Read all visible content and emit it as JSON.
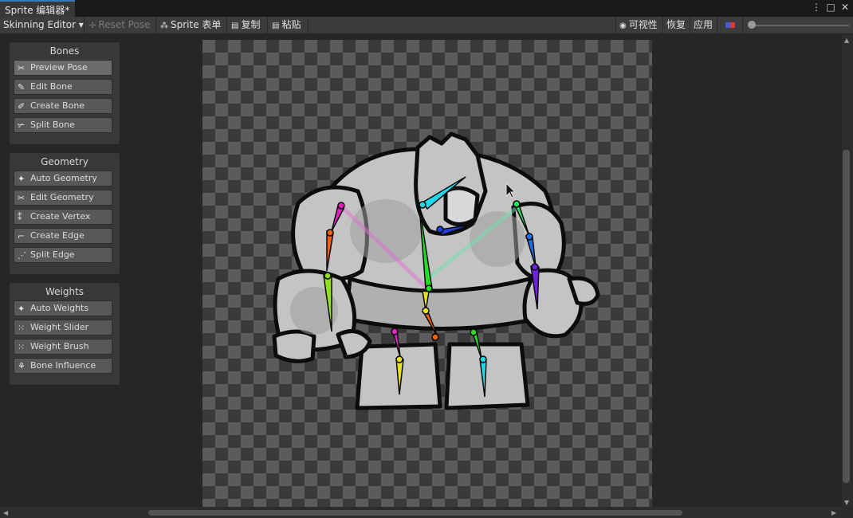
{
  "window": {
    "tab_title": "Sprite 编辑器*",
    "controls": [
      "more-icon",
      "maximize-icon",
      "close-icon"
    ]
  },
  "toolbar": {
    "mode_dropdown": "Skinning Editor ▾",
    "reset_pose": "Reset Pose",
    "sprite_sheet": "Sprite 表单",
    "copy": "复制",
    "paste": "粘贴",
    "visibility": "可视性",
    "revert": "恢复",
    "apply": "应用"
  },
  "panels": {
    "bones": {
      "title": "Bones",
      "buttons": [
        "Preview Pose",
        "Edit Bone",
        "Create Bone",
        "Split Bone"
      ]
    },
    "geometry": {
      "title": "Geometry",
      "buttons": [
        "Auto Geometry",
        "Edit Geometry",
        "Create Vertex",
        "Create Edge",
        "Split Edge"
      ]
    },
    "weights": {
      "title": "Weights",
      "buttons": [
        "Auto Weights",
        "Weight Slider",
        "Weight Brush",
        "Bone Influence"
      ]
    }
  },
  "colors": {
    "bone_cyan": "#22d8e8",
    "bone_green": "#22e020",
    "bone_blue": "#2040e0",
    "bone_magenta": "#e020c0",
    "bone_orange": "#f06010",
    "bone_yellow": "#e8e020",
    "bone_purple": "#7020e0",
    "bone_lime": "#90e020"
  }
}
